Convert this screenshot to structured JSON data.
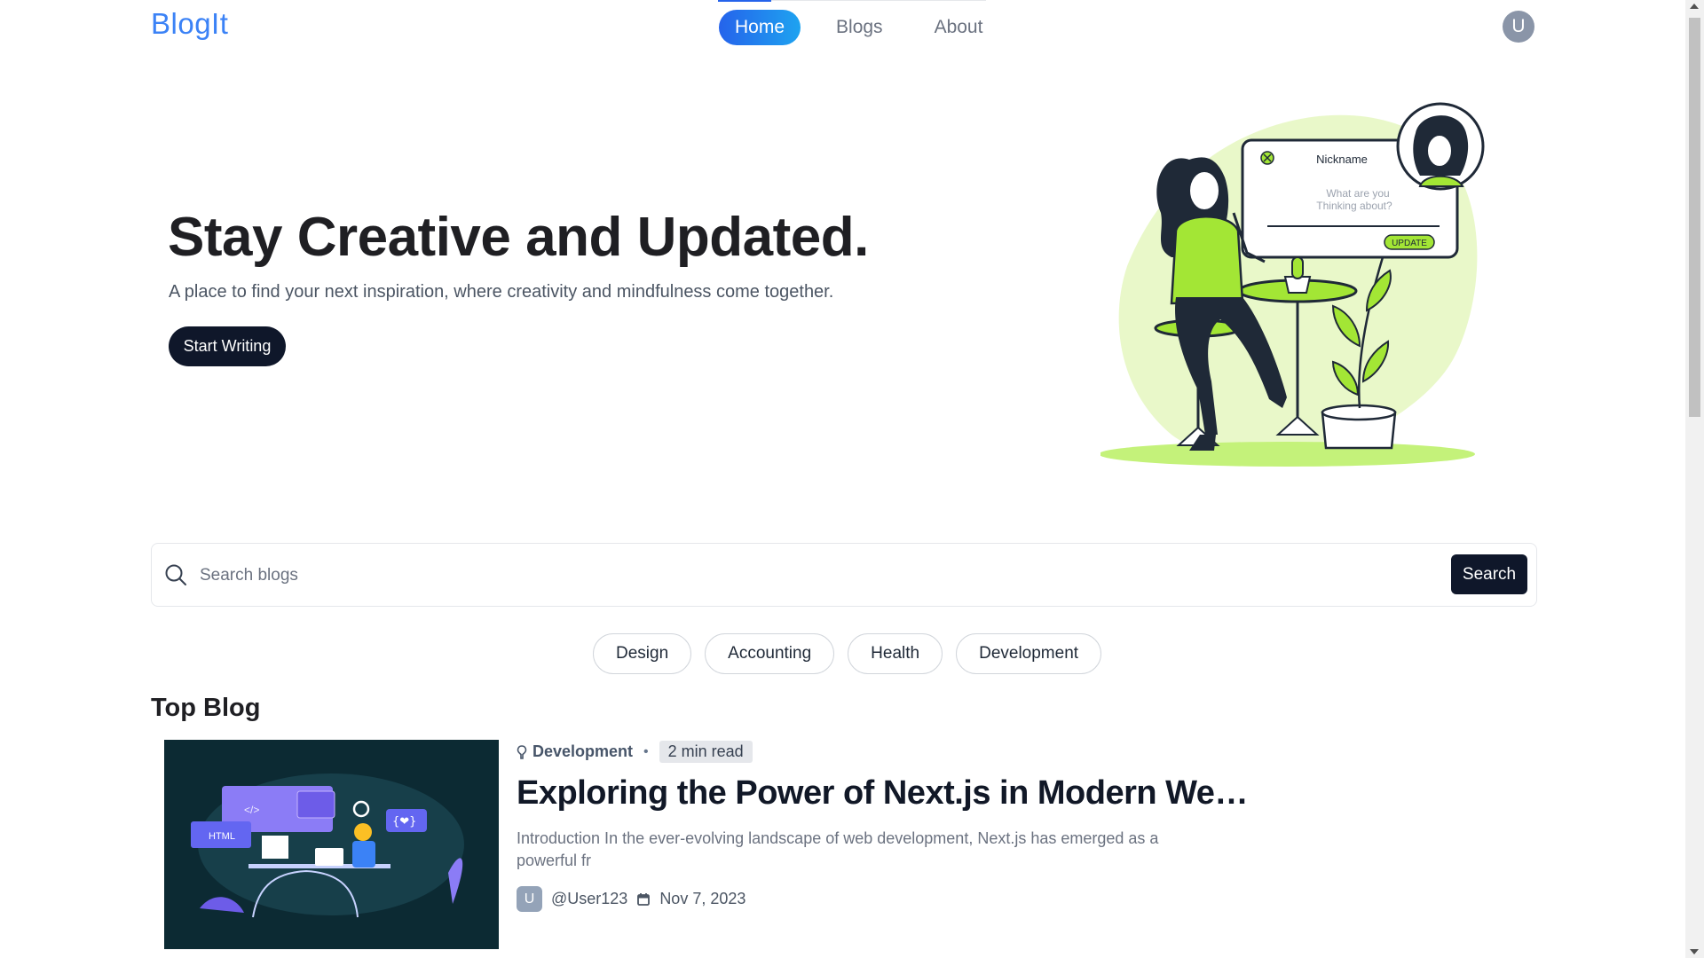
{
  "nav": {
    "brand": "BlogIt",
    "links": [
      {
        "label": "Home",
        "active": true
      },
      {
        "label": "Blogs",
        "active": false
      },
      {
        "label": "About",
        "active": false
      }
    ],
    "avatar_initial": "U"
  },
  "hero": {
    "title": "Stay Creative and Updated.",
    "subtitle": "A place to find your next inspiration, where creativity and mindfulness come together.",
    "cta_label": "Start Writing",
    "illustration": {
      "card_title": "Nickname",
      "card_placeholder_line1": "What are you",
      "card_placeholder_line2": "Thinking about?",
      "card_button": "UPDATE"
    }
  },
  "search": {
    "placeholder": "Search blogs",
    "value": "",
    "button_label": "Search"
  },
  "categories": [
    "Design",
    "Accounting",
    "Health",
    "Development"
  ],
  "top_blog": {
    "section_title": "Top Blog",
    "category": "Development",
    "read_time": "2 min read",
    "title": "Exploring the Power of Next.js in Modern Web ...",
    "excerpt": "Introduction In the ever-evolving landscape of web development, Next.js has emerged as a powerful fr",
    "author_initial": "U",
    "author": "@User123",
    "date": "Nov 7, 2023",
    "image_labels": {
      "html": "HTML",
      "code": "</>",
      "heart": "{❤}"
    }
  },
  "colors": {
    "brand": "#3b82f6",
    "primary_dark": "#0f172a",
    "accent_lime": "#a3e635",
    "blog_image_bg": "#0c2a33"
  }
}
